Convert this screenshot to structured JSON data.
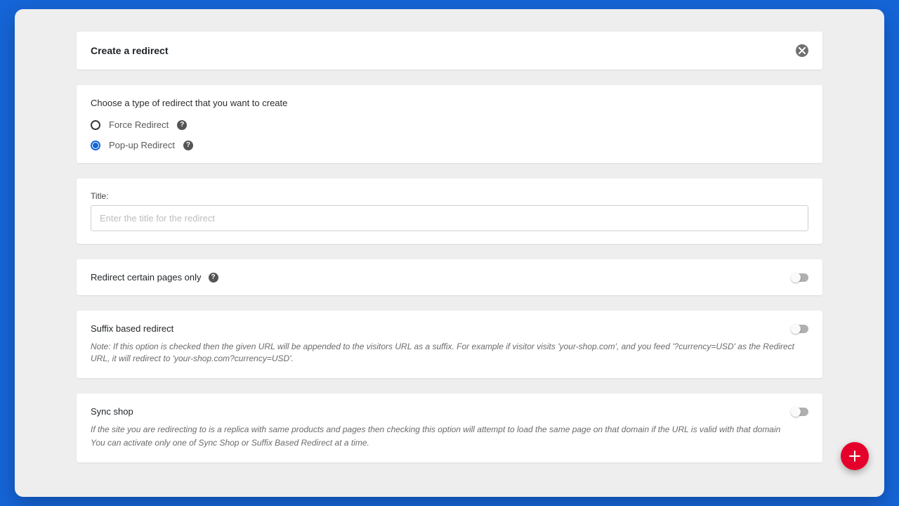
{
  "header": {
    "title": "Create a redirect"
  },
  "type_section": {
    "prompt": "Choose a type of redirect that you want to create",
    "options": [
      {
        "label": "Force Redirect",
        "selected": false
      },
      {
        "label": "Pop-up Redirect",
        "selected": true
      }
    ]
  },
  "title_section": {
    "label": "Title:",
    "placeholder": "Enter the title for the redirect",
    "value": ""
  },
  "pages_only": {
    "label": "Redirect certain pages only",
    "enabled": false
  },
  "suffix": {
    "label": "Suffix based redirect",
    "enabled": false,
    "note": "Note: If this option is checked then the given URL will be appended to the visitors URL as a suffix. For example if visitor visits 'your-shop.com', and you feed '?currency=USD' as the Redirect URL, it will redirect to 'your-shop.com?currency=USD'."
  },
  "sync": {
    "label": "Sync shop",
    "enabled": false,
    "note1": "If the site you are redirecting to is a replica with same products and pages then checking this option will attempt to load the same page on that domain if the URL is valid with that domain",
    "note2": "You can activate only one of Sync Shop or Suffix Based Redirect at a time."
  }
}
